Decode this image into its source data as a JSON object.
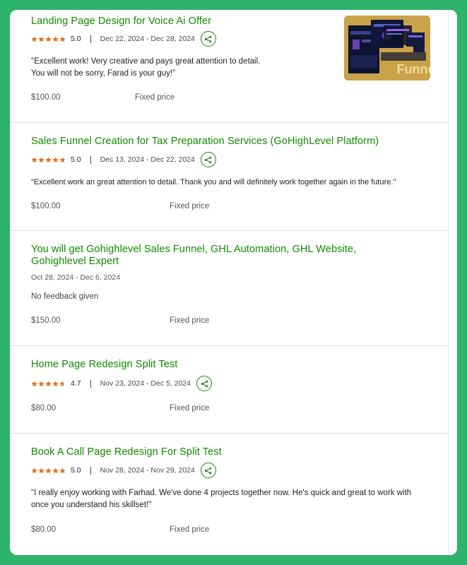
{
  "colors": {
    "brand_green": "#108a00",
    "star_orange": "#e2711d",
    "frame_bg": "#2db36b"
  },
  "items": [
    {
      "title": "Landing Page Design for Voice Ai Offer",
      "rating": "5.0",
      "stars": 5,
      "dates": "Dec 22, 2024 - Dec 28, 2024",
      "feedback": "\"Excellent work! Very creative and pays great attention to detail.\nYou will not be sorry, Farad is your guy!\"",
      "amount": "$100.00",
      "price_type": "Fixed price",
      "thumbnail_text": "Funnel"
    },
    {
      "title": "Sales Funnel Creation for Tax Preparation Services (GoHighLevel Platform)",
      "rating": "5.0",
      "stars": 5,
      "dates": "Dec 13, 2024 - Dec 22, 2024",
      "feedback": "\"Excellent work an great attention to detail. Thank you and will definitely work together again in the future.\"",
      "amount": "$100.00",
      "price_type": "Fixed price"
    },
    {
      "title": "You will get Gohighlevel Sales Funnel, GHL Automation, GHL Website, Gohighlevel Expert",
      "dates": "Oct 28, 2024 - Dec 6, 2024",
      "feedback": "No feedback given",
      "amount": "$150.00",
      "price_type": "Fixed price"
    },
    {
      "title": "Home Page Redesign Split Test",
      "rating": "4.7",
      "stars": 4.7,
      "dates": "Nov 23, 2024 - Dec 5, 2024",
      "amount": "$80.00",
      "price_type": "Fixed price"
    },
    {
      "title": "Book A Call Page Redesign For Split Test",
      "rating": "5.0",
      "stars": 5,
      "dates": "Nov 28, 2024 - Nov 29, 2024",
      "feedback": "\"I really enjoy working with Farhad. We've done 4 projects together now. He's quick and great to work with once you understand his skillset!\"",
      "amount": "$80.00",
      "price_type": "Fixed price"
    }
  ]
}
